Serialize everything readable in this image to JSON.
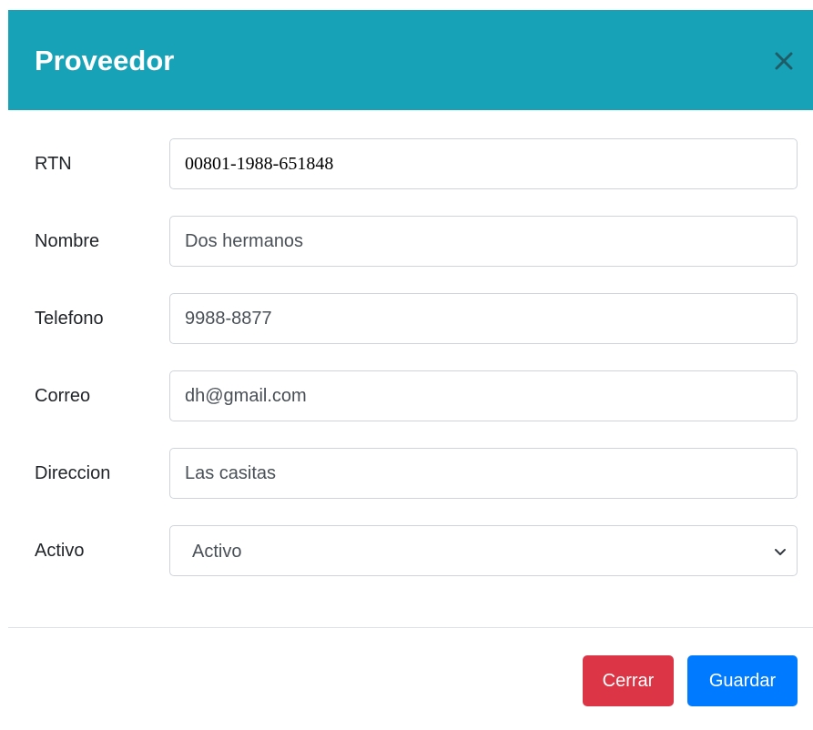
{
  "modal": {
    "title": "Proveedor",
    "colors": {
      "header_bg": "#17a2b8",
      "close_button": "#dc3545",
      "save_button": "#007bff"
    }
  },
  "form": {
    "rtn": {
      "label": "RTN",
      "value": "00801-1988-651848"
    },
    "nombre": {
      "label": "Nombre",
      "value": "Dos hermanos"
    },
    "telefono": {
      "label": "Telefono",
      "value": "9988-8877"
    },
    "correo": {
      "label": "Correo",
      "value": "dh@gmail.com"
    },
    "direccion": {
      "label": "Direccion",
      "value": "Las casitas"
    },
    "activo": {
      "label": "Activo",
      "selected": "Activo"
    }
  },
  "footer": {
    "close_label": "Cerrar",
    "save_label": "Guardar"
  },
  "icons": {
    "close": "close-icon",
    "select_arrow": "chevron-down-icon"
  }
}
